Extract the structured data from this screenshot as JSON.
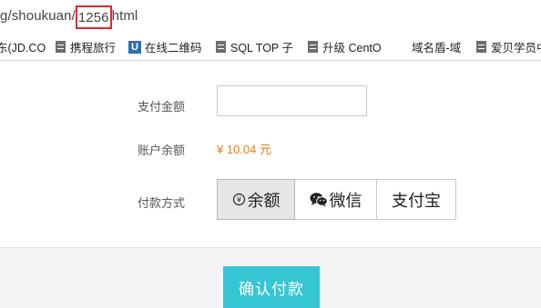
{
  "address_bar": {
    "url_prefix": "g/shoukuan/",
    "url_highlight": "1256",
    "url_suffix": "html",
    "highlight_color": "#e8252d"
  },
  "bookmarks": [
    {
      "label": "东(JD.CO",
      "icon": "none"
    },
    {
      "label": "携程旅行",
      "icon": "page-icon"
    },
    {
      "label": "在线二维码",
      "icon": "u-icon"
    },
    {
      "label": "SQL TOP 子",
      "icon": "page-icon"
    },
    {
      "label": "升级 CentO",
      "icon": "page-icon"
    },
    {
      "label": "域名盾-域",
      "icon": "none"
    },
    {
      "label": "爱贝学员中",
      "icon": "page-icon"
    }
  ],
  "form": {
    "amount_label": "支付金额",
    "amount_value": "",
    "amount_placeholder": "",
    "balance_label": "账户余额",
    "balance_value": "¥ 10.04 元",
    "balance_color": "#ef7b12",
    "method_label": "付款方式",
    "methods": [
      {
        "label": "余额",
        "icon": "coin-icon",
        "selected": true
      },
      {
        "label": "微信",
        "icon": "wechat-icon",
        "selected": false
      },
      {
        "label": "支付宝",
        "icon": "none",
        "selected": false
      }
    ]
  },
  "confirm_button": {
    "label": "确认付款",
    "color": "#36c6d3"
  }
}
